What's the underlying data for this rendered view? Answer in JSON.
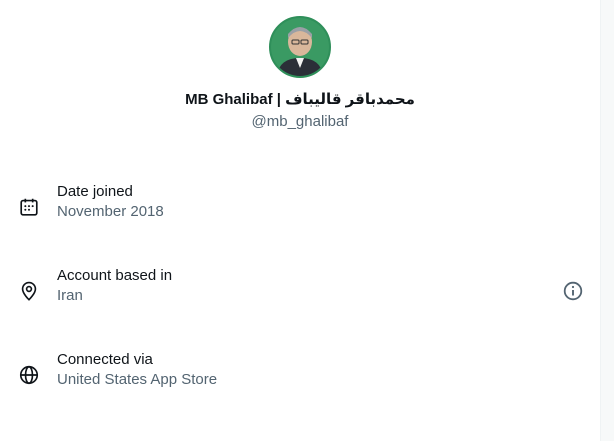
{
  "profile": {
    "display_name": "MB Ghalibaf | محمدباقر قالیباف",
    "handle": "@mb_ghalibaf",
    "avatar_icon": "profile-photo"
  },
  "about": [
    {
      "icon": "calendar-icon",
      "label": "Date joined",
      "value": "November 2018"
    },
    {
      "icon": "location-pin-icon",
      "label": "Account based in",
      "value": "Iran",
      "action_icon": "info-icon"
    },
    {
      "icon": "globe-icon",
      "label": "Connected via",
      "value": "United States App Store"
    }
  ],
  "colors": {
    "primary_text": "#0f1419",
    "secondary_text": "#536471",
    "avatar_ring": "#2f8f5a"
  }
}
